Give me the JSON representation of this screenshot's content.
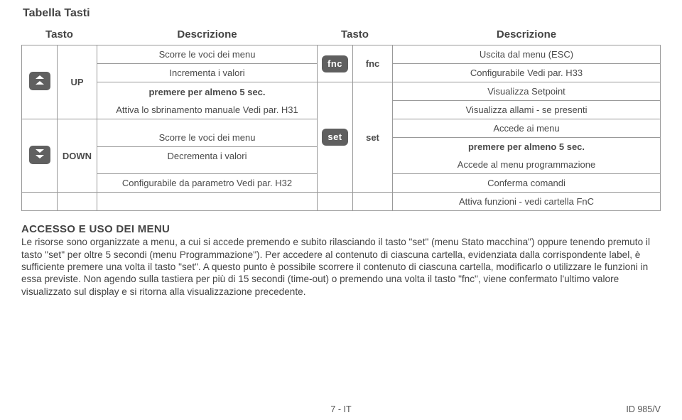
{
  "title": "Tabella Tasti",
  "headers": {
    "col1": "Tasto",
    "col2": "Descrizione",
    "col3": "Tasto",
    "col4": "Descrizione"
  },
  "left": {
    "up": {
      "label": "UP",
      "lines": [
        "Scorre le voci dei menu",
        "Incrementa i valori",
        "premere per almeno 5 sec.",
        "Attiva lo sbrinamento manuale Vedi par. H31"
      ]
    },
    "down": {
      "label": "DOWN",
      "lines": [
        "Scorre le voci dei menu",
        "Decrementa i valori",
        "Configurabile da parametro Vedi par. H32"
      ]
    }
  },
  "right": {
    "fnc": {
      "icon": "fnc",
      "label": "fnc",
      "lines": [
        "Uscita dal menu (ESC)",
        "Configurabile Vedi par. H33"
      ]
    },
    "set": {
      "icon": "set",
      "label": "set",
      "lines": [
        "Visualizza Setpoint",
        "Visualizza allami - se presenti",
        "Accede ai menu",
        "premere per almeno 5 sec.",
        "Accede al menu programmazione",
        "Conferma comandi"
      ]
    },
    "extra": "Attiva funzioni - vedi cartella FnC"
  },
  "section": {
    "heading": "ACCESSO E USO DEI MENU",
    "text": "Le risorse sono organizzate a menu, a cui si accede premendo e subito rilasciando il tasto \"set\" (menu Stato macchina\") oppure tenendo premuto il tasto \"set\" per oltre 5 secondi (menu Programmazione\"). Per accedere al contenuto di ciascuna cartella, evidenziata dalla corrispondente label, è sufficiente premere una volta il tasto \"set\". A questo punto è possibile scorrere il contenuto di ciascuna cartella, modificarlo o utilizzare le funzioni in essa previste. Non agendo sulla tastiera per più di 15 secondi (time-out) o premendo una volta il tasto \"fnc\", viene confermato l'ultimo valore visualizzato sul display e si ritorna alla visualizzazione precedente."
  },
  "footer": {
    "center": "7 - IT",
    "right": "ID 985/V"
  }
}
